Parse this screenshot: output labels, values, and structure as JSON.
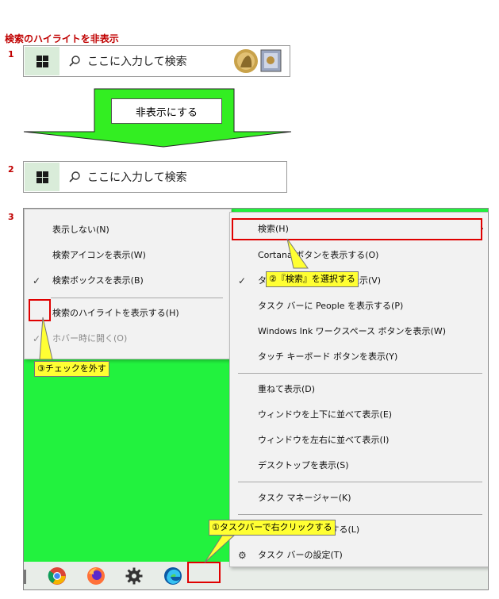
{
  "title": "検索のハイライトを非表示",
  "steps": {
    "s1": "1",
    "s2": "2",
    "s3": "3"
  },
  "searchbar1": {
    "placeholder": "ここに入力して検索",
    "highlight_icon": "search-highlight-medal-icon"
  },
  "searchbar2": {
    "placeholder": "ここに入力して検索"
  },
  "arrow_label": "非表示にする",
  "search_submenu": {
    "items": [
      {
        "label": "表示しない(N)",
        "checked": false
      },
      {
        "label": "検索アイコンを表示(W)",
        "checked": false
      },
      {
        "label": "検索ボックスを表示(B)",
        "checked": true
      },
      {
        "label": "検索のハイライトを表示する(H)",
        "checked": false
      },
      {
        "label": "ホバー時に開く(O)",
        "checked": true,
        "disabled": true
      }
    ]
  },
  "context_menu": {
    "items": [
      {
        "label": "検索(H)",
        "submenu": true
      },
      {
        "label": "Cortana ボタンを表示する(O)"
      },
      {
        "label": "タスク ビュー ボタンを表示(V)",
        "checked": true
      },
      {
        "label": "タスク バーに People を表示する(P)"
      },
      {
        "label": "Windows Ink ワークスペース ボタンを表示(W)"
      },
      {
        "label": "タッチ キーボード ボタンを表示(Y)"
      },
      {
        "label": "重ねて表示(D)"
      },
      {
        "label": "ウィンドウを上下に並べて表示(E)"
      },
      {
        "label": "ウィンドウを左右に並べて表示(I)"
      },
      {
        "label": "デスクトップを表示(S)"
      },
      {
        "label": "タスク マネージャー(K)"
      },
      {
        "label": "タスク バーを固定する(L)"
      },
      {
        "label": "タスク バーの設定(T)"
      }
    ]
  },
  "callouts": {
    "c1": "①タスクバーで右クリックする",
    "c2": "②『検索』を選択する",
    "c3": "③チェックを外す"
  },
  "taskbar_icons": [
    "chrome-icon",
    "firefox-icon",
    "settings-gear-icon",
    "edge-icon"
  ],
  "colors": {
    "desktop": "#22f23e",
    "arrow": "#33ee22",
    "accent_red": "#e00000",
    "callout": "#ffff33"
  }
}
